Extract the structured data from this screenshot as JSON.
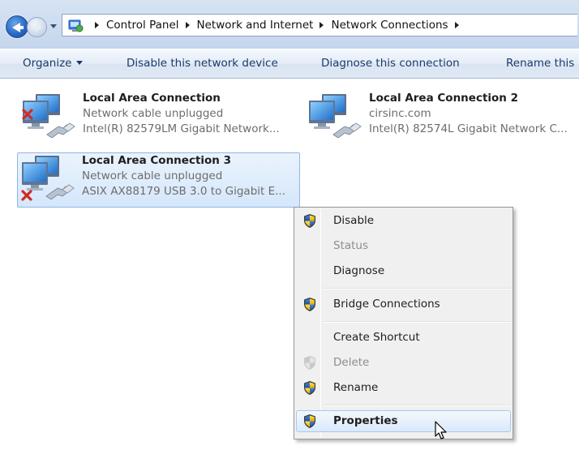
{
  "address": {
    "crumbs": [
      "Control Panel",
      "Network and Internet",
      "Network Connections"
    ]
  },
  "toolbar": {
    "organize": "Organize",
    "disable_device": "Disable this network device",
    "diagnose": "Diagnose this connection",
    "rename": "Rename this"
  },
  "connections": [
    {
      "name": "Local Area Connection",
      "status": "Network cable unplugged",
      "device": "Intel(R) 82579LM Gigabit Network...",
      "state": "disconnected"
    },
    {
      "name": "Local Area Connection 2",
      "status": "cirsinc.com",
      "device": "Intel(R) 82574L Gigabit Network C...",
      "state": "connected"
    },
    {
      "name": "Local Area Connection 3",
      "status": "Network cable unplugged",
      "device": "ASIX AX88179 USB 3.0 to Gigabit E...",
      "state": "disconnected",
      "selected": true
    }
  ],
  "context_menu": {
    "items": [
      {
        "label": "Disable",
        "shield": true
      },
      {
        "label": "Status",
        "disabled": true
      },
      {
        "label": "Diagnose"
      },
      {
        "label": "Bridge Connections",
        "shield": true
      },
      {
        "label": "Create Shortcut"
      },
      {
        "label": "Delete",
        "shield": true,
        "disabled": true
      },
      {
        "label": "Rename",
        "shield": true
      },
      {
        "label": "Properties",
        "shield": true,
        "default": true,
        "hover": true
      }
    ]
  },
  "icons": {
    "back": "back-arrow-icon",
    "forward": "forward-arrow-icon",
    "control_panel": "control-panel-icon",
    "connection": "network-adapter-icon",
    "error": "red-x-icon",
    "uac": "uac-shield-icon",
    "cursor": "mouse-pointer-icon"
  },
  "colors": {
    "selection_bg": "#d5e7fb",
    "selection_border": "#8fb6e5",
    "menu_bg": "#f0f0f0",
    "error_red": "#d42a1f"
  }
}
